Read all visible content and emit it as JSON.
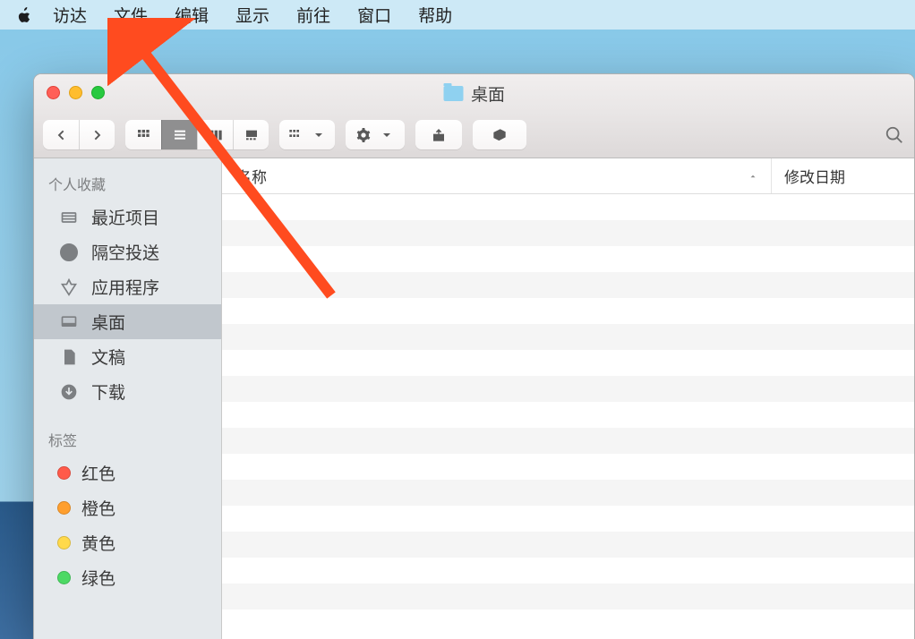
{
  "menubar": {
    "items": [
      "访达",
      "文件",
      "编辑",
      "显示",
      "前往",
      "窗口",
      "帮助"
    ]
  },
  "window": {
    "title": "桌面"
  },
  "sidebar": {
    "favorites_header": "个人收藏",
    "items": [
      {
        "label": "最近项目"
      },
      {
        "label": "隔空投送"
      },
      {
        "label": "应用程序"
      },
      {
        "label": "桌面"
      },
      {
        "label": "文稿"
      },
      {
        "label": "下载"
      }
    ],
    "tags_header": "标签",
    "tags": [
      {
        "label": "红色",
        "color": "#ff5a4a"
      },
      {
        "label": "橙色",
        "color": "#ff9f2e"
      },
      {
        "label": "黄色",
        "color": "#ffd94a"
      },
      {
        "label": "绿色",
        "color": "#4cd964"
      }
    ]
  },
  "columns": {
    "name": "名称",
    "modified": "修改日期"
  }
}
